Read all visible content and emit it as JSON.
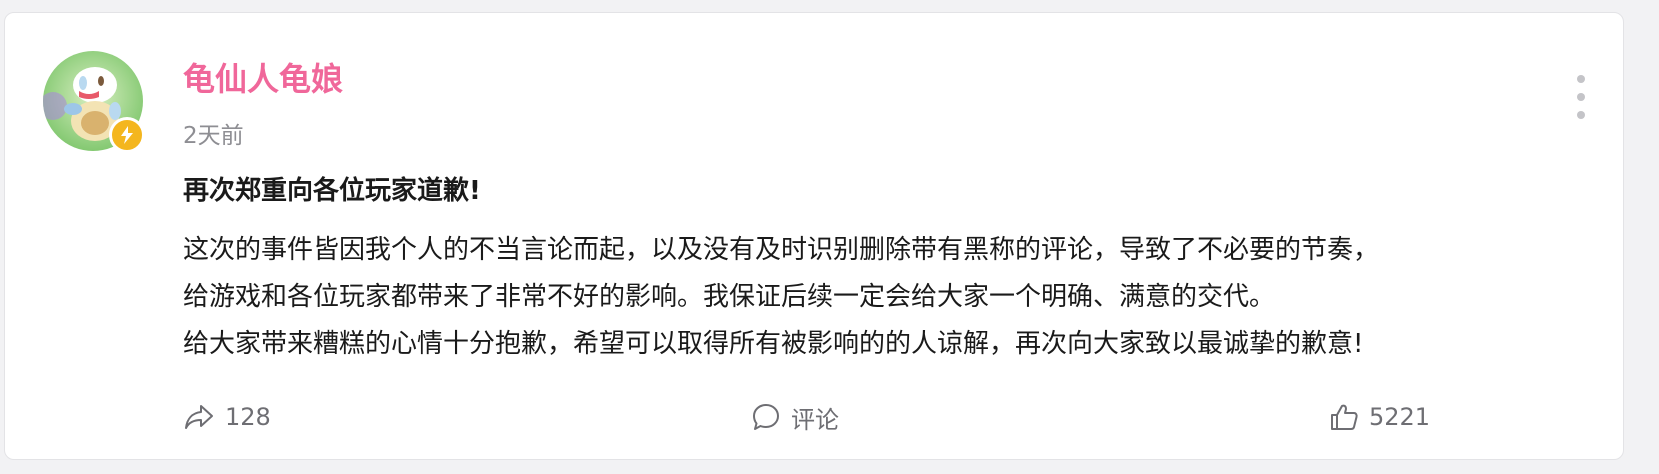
{
  "post": {
    "author": "龟仙人龟娘",
    "time": "2天前",
    "title": "再次郑重向各位玩家道歉!",
    "body_lines": [
      "这次的事件皆因我个人的不当言论而起，以及没有及时识别删除带有黑称的评论，导致了不必要的节奏，",
      "给游戏和各位玩家都带来了非常不好的影响。我保证后续一定会给大家一个明确、满意的交代。",
      "给大家带来糟糕的心情十分抱歉，希望可以取得所有被影响的的人谅解，再次向大家致以最诚挚的歉意!"
    ]
  },
  "actions": {
    "share_count": "128",
    "comment_label": "评论",
    "like_count": "5221"
  },
  "icons": {
    "share": "share-arrow-icon",
    "comment": "comment-bubble-icon",
    "like": "thumbs-up-icon",
    "more": "more-vertical-icon",
    "badge": "lightning-icon"
  },
  "colors": {
    "author_name": "#f0679a",
    "badge": "#f4b61e",
    "text": "#1a1a1a",
    "muted": "#8e8e93"
  }
}
